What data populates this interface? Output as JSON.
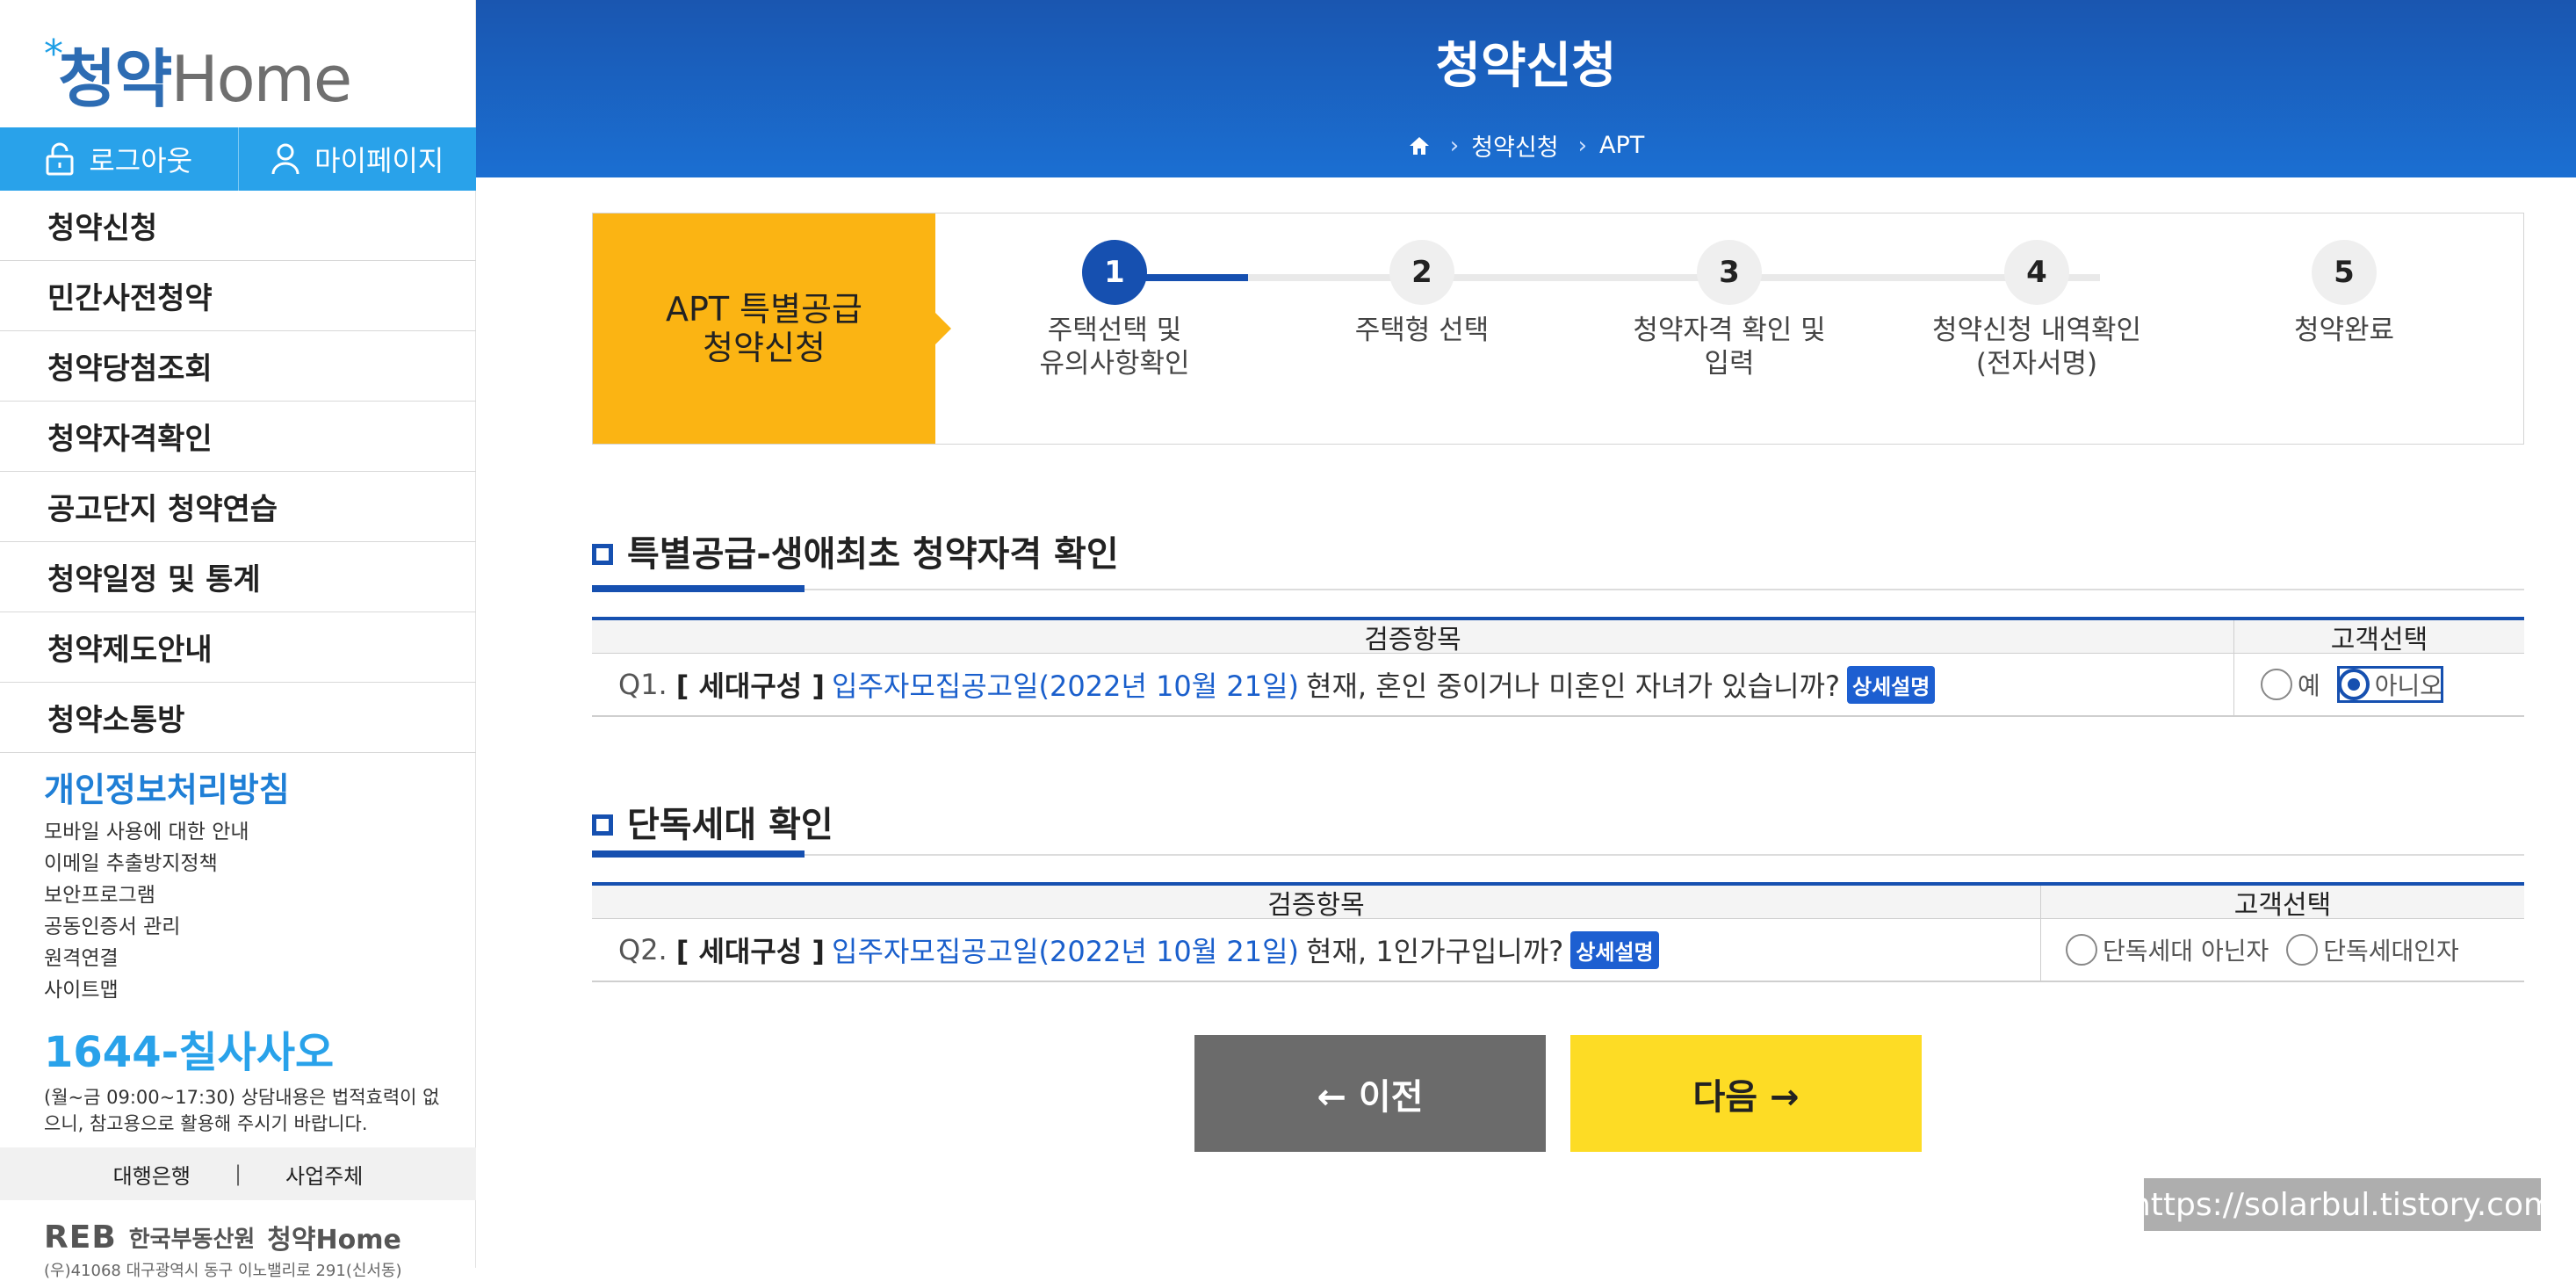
{
  "sidebar": {
    "logo": {
      "main": "청약",
      "suffix": "Home",
      "star": "*"
    },
    "auth": {
      "logout": "로그아웃",
      "mypage": "마이페이지"
    },
    "menu": [
      "청약신청",
      "민간사전청약",
      "청약당첨조회",
      "청약자격확인",
      "공고단지 청약연습",
      "청약일정 및 통계",
      "청약제도안내",
      "청약소통방"
    ],
    "privacy": {
      "title": "개인정보처리방침",
      "links": [
        "모바일 사용에 대한 안내",
        "이메일 추출방지정책",
        "보안프로그램",
        "공동인증서 관리",
        "원격연결",
        "사이트맵"
      ]
    },
    "callcenter": {
      "phone": "1644-칠사사오",
      "hours": "(월~금 09:00~17:30) 상담내용은 법적효력이 없으니, 참고용으로 활용해 주시기 바랍니다."
    },
    "bottom_links": [
      "대행은행",
      "사업주체"
    ],
    "footer": {
      "reb": "REB",
      "org": "한국부동산원",
      "brand": "청약Home",
      "address": "(우)41068 대구광역시 동구 이노밸리로 291(신서동)"
    }
  },
  "header": {
    "title": "청약신청",
    "breadcrumb": [
      "청약신청",
      "APT"
    ]
  },
  "steps": {
    "banner": [
      "APT 특별공급",
      "청약신청"
    ],
    "items": [
      {
        "num": "1",
        "label": [
          "주택선택 및",
          "유의사항확인"
        ],
        "active": true
      },
      {
        "num": "2",
        "label": [
          "주택형 선택"
        ],
        "active": false
      },
      {
        "num": "3",
        "label": [
          "청약자격 확인 및",
          "입력"
        ],
        "active": false
      },
      {
        "num": "4",
        "label": [
          "청약신청 내역확인",
          "(전자서명)"
        ],
        "active": false
      },
      {
        "num": "5",
        "label": [
          "청약완료"
        ],
        "active": false
      }
    ]
  },
  "section1": {
    "title": "특별공급-생애최초 청약자격 확인",
    "col_item": "검증항목",
    "col_choice": "고객선택",
    "q": {
      "num": "Q1.",
      "category": "[ 세대구성 ]",
      "date": "입주자모집공고일(2022년 10월 21일)",
      "text": "현재, 혼인 중이거나 미혼인 자녀가 있습니까?",
      "badge": "상세설명",
      "options": [
        {
          "label": "예",
          "checked": false
        },
        {
          "label": "아니오",
          "checked": true
        }
      ]
    }
  },
  "section2": {
    "title": "단독세대 확인",
    "col_item": "검증항목",
    "col_choice": "고객선택",
    "q": {
      "num": "Q2.",
      "category": "[ 세대구성 ]",
      "date": "입주자모집공고일(2022년 10월 21일)",
      "text": "현재, 1인가구입니까?",
      "badge": "상세설명",
      "options": [
        {
          "label": "단독세대 아닌자",
          "checked": false
        },
        {
          "label": "단독세대인자",
          "checked": false
        }
      ]
    }
  },
  "buttons": {
    "prev": "← 이전",
    "next": "다음 →"
  },
  "watermark": "https://solarbul.tistory.com",
  "colors": {
    "primary": "#1650b0",
    "sky": "#29a2ea",
    "banner": "#fbb413",
    "next": "#fddc25",
    "prev": "#6b6b6b"
  }
}
